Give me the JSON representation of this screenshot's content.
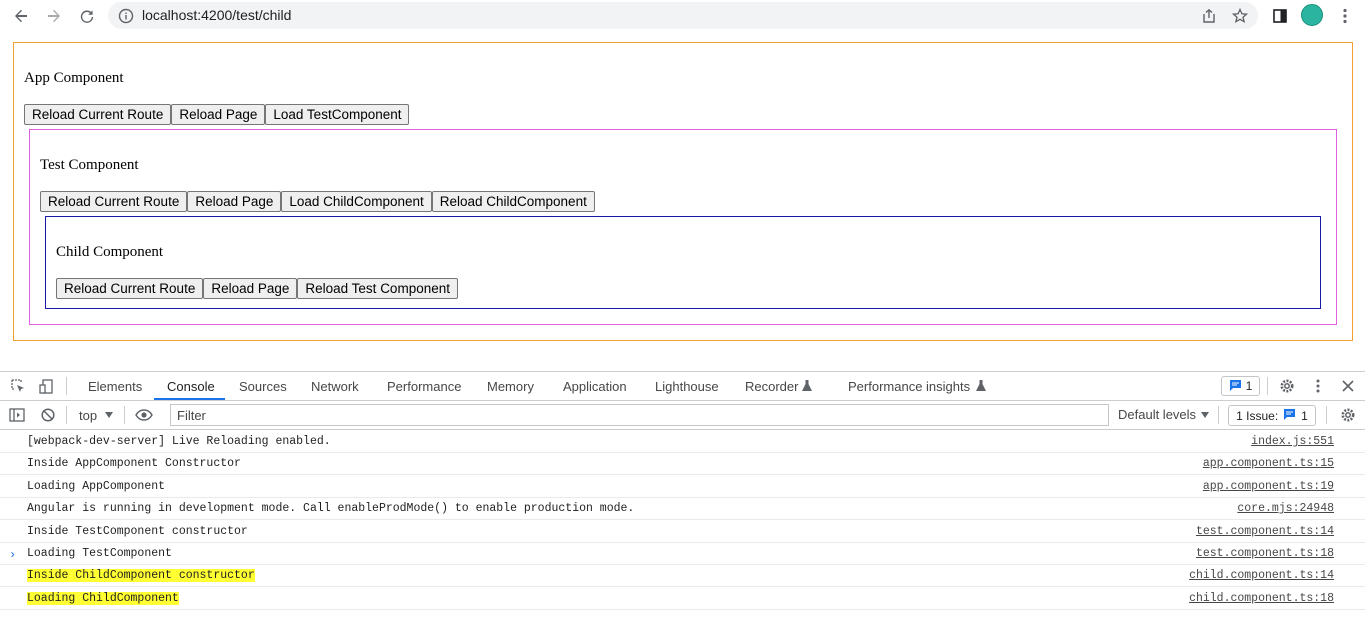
{
  "browser": {
    "url": "localhost:4200/test/child",
    "icons": [
      "back-arrow-icon",
      "forward-arrow-icon",
      "reload-icon",
      "info-icon",
      "share-icon",
      "star-icon",
      "sidebar-icon",
      "avatar",
      "more-vert-icon"
    ]
  },
  "app": {
    "title": "App Component",
    "buttons": [
      "Reload Current Route",
      "Reload Page",
      "Load TestComponent"
    ]
  },
  "test": {
    "title": "Test Component",
    "buttons": [
      "Reload Current Route",
      "Reload Page",
      "Load ChildComponent",
      "Reload ChildComponent"
    ]
  },
  "child": {
    "title": "Child Component",
    "buttons": [
      "Reload Current Route",
      "Reload Page",
      "Reload Test Component"
    ]
  },
  "colors": {
    "app_border": "#f0a030",
    "test_border": "#e060e0",
    "child_border": "#1a1aa8",
    "highlight": "#ffff33"
  },
  "devtools": {
    "tabs": [
      "Elements",
      "Console",
      "Sources",
      "Network",
      "Performance",
      "Memory",
      "Application",
      "Lighthouse",
      "Recorder",
      "Performance insights"
    ],
    "active_tab": "Console",
    "message_count": "1",
    "context": "top",
    "filter_placeholder": "Filter",
    "levels": "Default levels",
    "issues_label": "1 Issue:",
    "issues_count": "1",
    "logs": [
      {
        "message": "[webpack-dev-server] Live Reloading enabled.",
        "source": "index.js:551",
        "highlight": false
      },
      {
        "message": "Inside AppComponent Constructor",
        "source": "app.component.ts:15",
        "highlight": false
      },
      {
        "message": "Loading AppComponent",
        "source": "app.component.ts:19",
        "highlight": false
      },
      {
        "message": "Angular is running in development mode. Call enableProdMode() to enable production mode.",
        "source": "core.mjs:24948",
        "highlight": false
      },
      {
        "message": "Inside TestComponent constructor",
        "source": "test.component.ts:14",
        "highlight": false
      },
      {
        "message": "Loading TestComponent",
        "source": "test.component.ts:18",
        "highlight": false
      },
      {
        "message": "Inside ChildComponent constructor",
        "source": "child.component.ts:14",
        "highlight": true
      },
      {
        "message": "Loading ChildComponent",
        "source": "child.component.ts:18",
        "highlight": true
      }
    ]
  }
}
